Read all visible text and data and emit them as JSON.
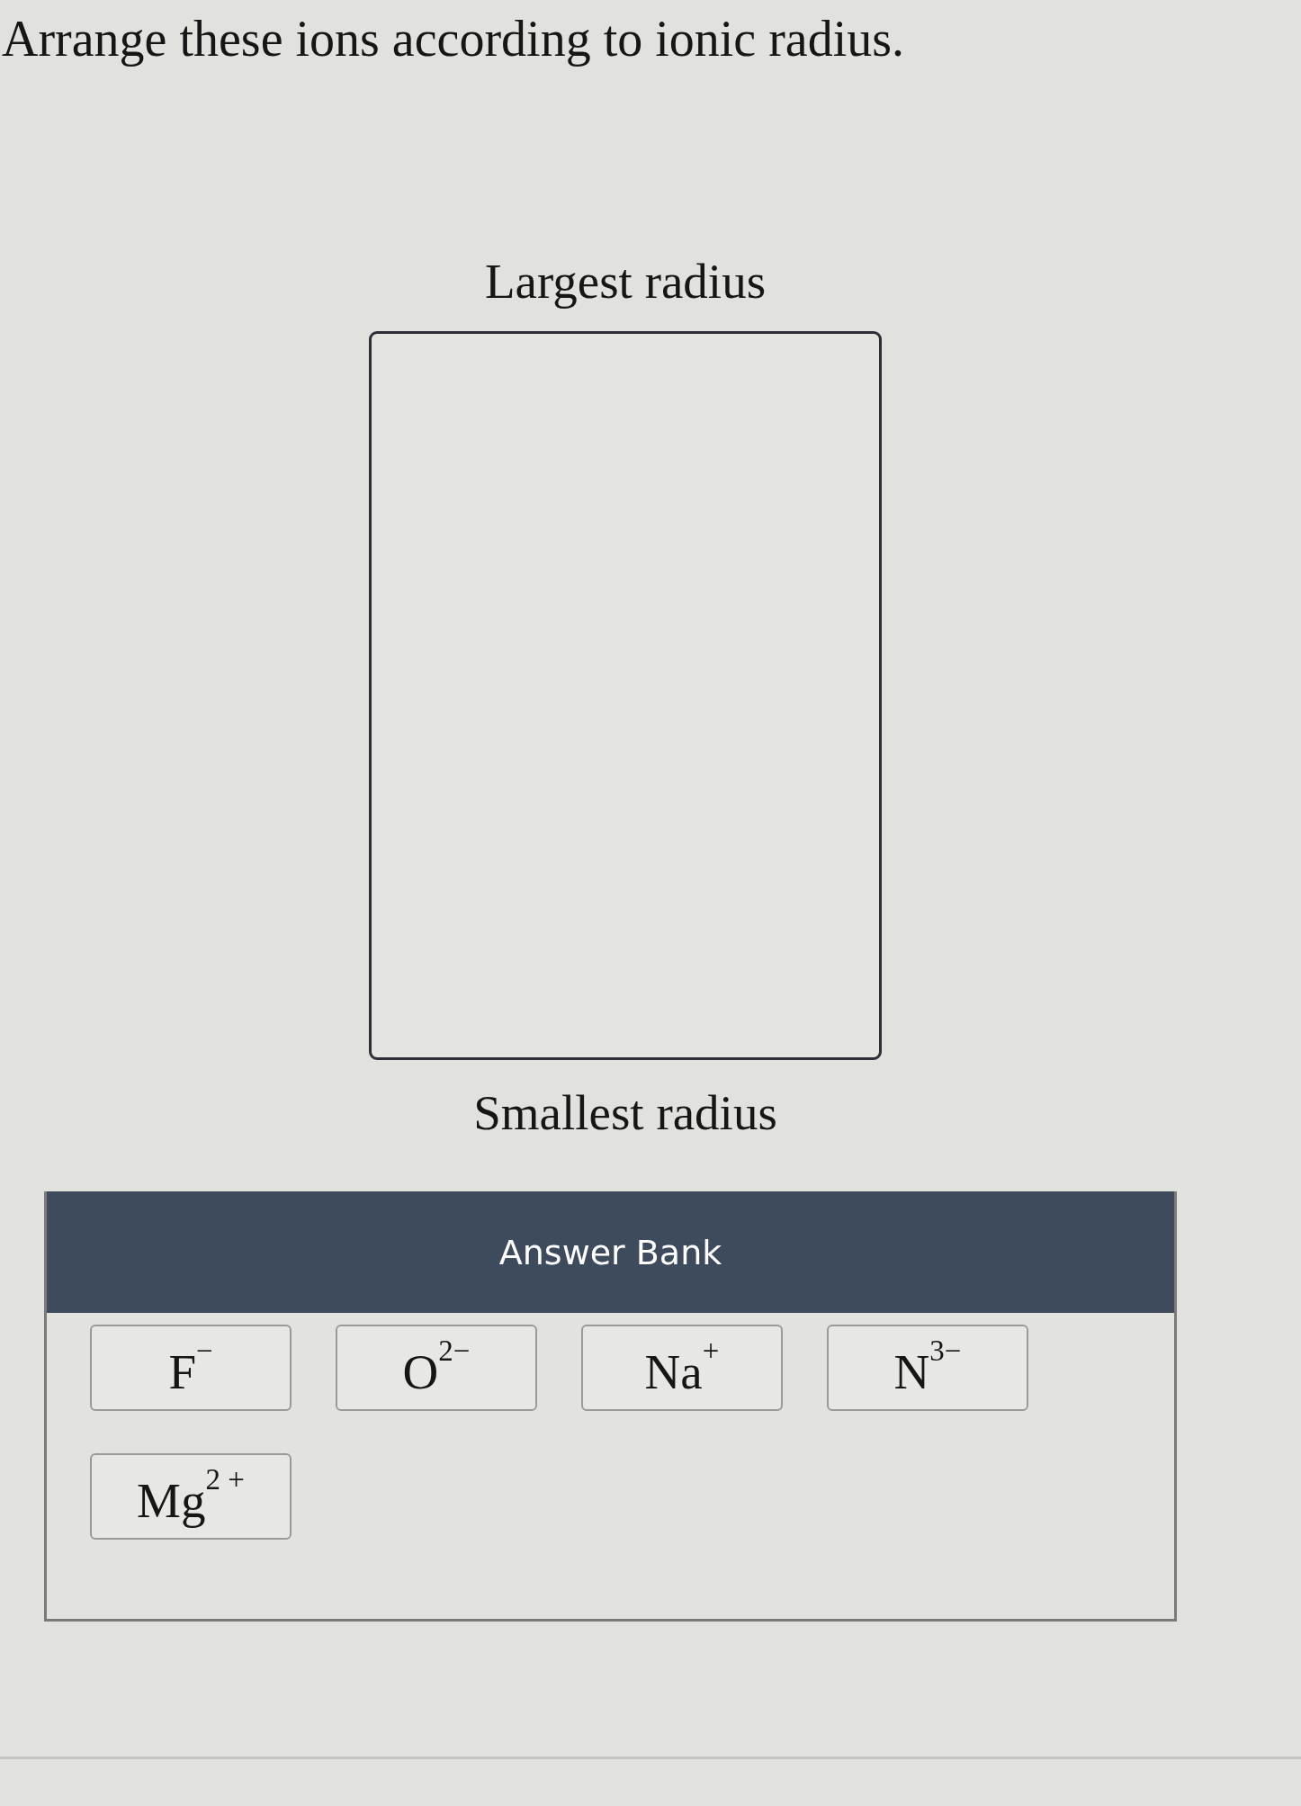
{
  "question": {
    "prompt": "Arrange these ions according to ionic radius."
  },
  "ranking": {
    "top_label": "Largest radius",
    "bottom_label": "Smallest radius"
  },
  "answer_bank": {
    "title": "Answer Bank",
    "items": [
      {
        "label": "F$^{−}$"
      },
      {
        "label": "O$^{2−}$"
      },
      {
        "label": "Na$^{+}$"
      },
      {
        "label": "N$^{3−}$"
      },
      {
        "label": "Mg$^{2 +}$"
      }
    ]
  }
}
